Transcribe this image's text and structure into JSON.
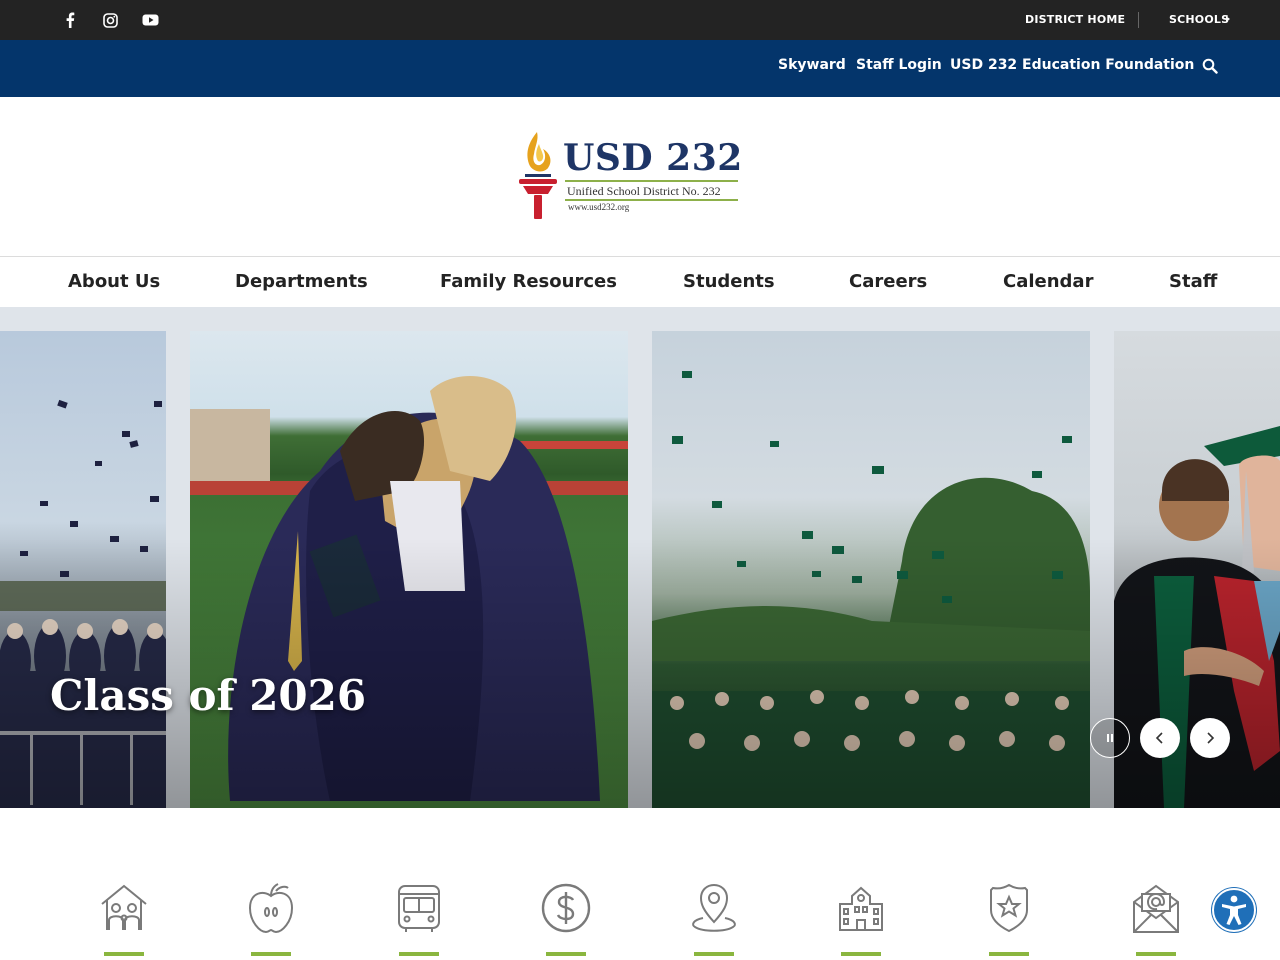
{
  "topbar": {
    "social_icons": [
      "facebook-icon",
      "instagram-icon",
      "youtube-icon"
    ],
    "district_home": "DISTRICT HOME",
    "schools": "SCHOOLS"
  },
  "quickbar": {
    "links": [
      "Skyward",
      "Staff Login",
      "USD 232 Education Foundation"
    ],
    "search_icon": "search-icon"
  },
  "logo": {
    "title": "USD 232",
    "subtitle": "Unified School District No. 232",
    "url": "www.usd232.org"
  },
  "nav": {
    "items": [
      "About Us",
      "Departments",
      "Family Resources",
      "Students",
      "Careers",
      "Calendar",
      "Staff"
    ]
  },
  "hero": {
    "caption": "Class of 2026",
    "controls": [
      "pause-icon",
      "chevron-left-icon",
      "chevron-right-icon"
    ]
  },
  "quick_icons": [
    "family-icon",
    "apple-icon",
    "bus-icon",
    "dollar-icon",
    "map-pin-icon",
    "school-building-icon",
    "badge-star-icon",
    "email-icon"
  ],
  "colors": {
    "topbar": "#232323",
    "quickbar": "#04356b",
    "accent_green": "#8ab63f",
    "logo_navy": "#1e3566",
    "accessibility_blue": "#1f6fb8"
  }
}
